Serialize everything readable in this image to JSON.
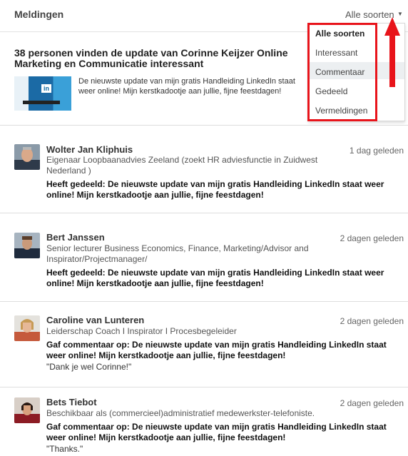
{
  "header": {
    "title": "Meldingen",
    "sort_label": "Alle soorten",
    "caret": "▼"
  },
  "dropdown": {
    "items": [
      "Alle soorten",
      "Interessant",
      "Commentaar",
      "Gedeeld",
      "Vermeldingen"
    ],
    "selected_index": 0,
    "hover_index": 2,
    "highlight_color": "#e8141b"
  },
  "update": {
    "headline": "38 personen vinden de update van Corinne Keijzer Online Marketing en Communicatie interessant",
    "snippet": "De nieuwste update van mijn gratis Handleiding LinkedIn staat weer online! Mijn kerstkadootje aan jullie, fijne feestdagen!",
    "thumb_icon": "in"
  },
  "posts": [
    {
      "name": "Wolter Jan Kliphuis",
      "time": "1 dag geleden",
      "role": "Eigenaar Loopbaanadvies Zeeland (zoekt HR adviesfunctie in Zuidwest Nederland )",
      "action": "Heeft gedeeld: De nieuwste update van mijn gratis Handleiding LinkedIn staat weer online! Mijn kerstkadootje aan jullie, fijne feestdagen!",
      "comment": ""
    },
    {
      "name": "Bert Janssen",
      "time": "2 dagen geleden",
      "role": "Senior lecturer Business Economics, Finance, Marketing/Advisor and Inspirator/Projectmanager/",
      "action": "Heeft gedeeld: De nieuwste update van mijn gratis Handleiding LinkedIn staat weer online! Mijn kerstkadootje aan jullie, fijne feestdagen!",
      "comment": ""
    },
    {
      "name": "Caroline van Lunteren",
      "time": "2 dagen geleden",
      "role": "Leiderschap Coach I Inspirator I Procesbegeleider",
      "action": "Gaf commentaar op: De nieuwste update van mijn gratis Handleiding LinkedIn staat weer online! Mijn kerstkadootje aan jullie, fijne feestdagen!",
      "comment": "\"Dank je wel Corinne!\""
    },
    {
      "name": "Bets Tiebot",
      "time": "2 dagen geleden",
      "role": "Beschikbaar als (commercieel)administratief medewerkster-telefoniste.",
      "action": "Gaf commentaar op: De nieuwste update van mijn gratis Handleiding LinkedIn staat weer online! Mijn kerstkadootje aan jullie, fijne feestdagen!",
      "comment": "\"Thanks.\""
    }
  ]
}
